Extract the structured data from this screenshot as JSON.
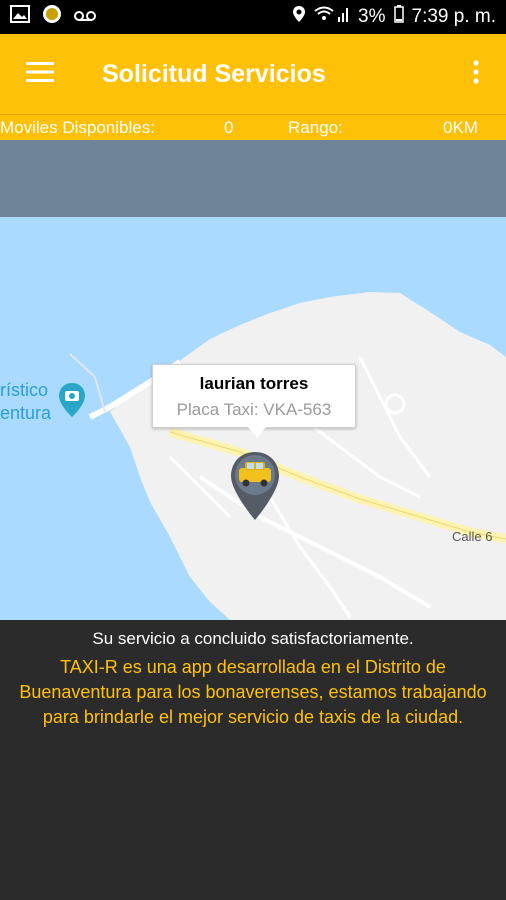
{
  "status_bar": {
    "battery": "3%",
    "time": "7:39 p. m."
  },
  "appbar": {
    "title": "Solicitud Servicios"
  },
  "info_bar": {
    "moviles_label": "Moviles Disponibles:",
    "moviles_value": "0",
    "rango_label": "Rango:",
    "rango_value": "0KM"
  },
  "map": {
    "place_label_line1": "rístico",
    "place_label_line2": "entura",
    "street_label": "Calle 6",
    "marker": {
      "driver_name": "laurian torres",
      "plate": "Placa Taxi: VKA-563"
    }
  },
  "footer": {
    "status_message": "Su servicio a concluido satisfactoriamente.",
    "info_message": "TAXI-R es una app desarrollada en el Distrito de Buenaventura para los bonaverenses, estamos trabajando para brindarle el mejor servicio de taxis de la ciudad."
  },
  "colors": {
    "accent": "#ffc107",
    "map_water": "#aadaff",
    "dark_panel": "#2b2b2b"
  }
}
